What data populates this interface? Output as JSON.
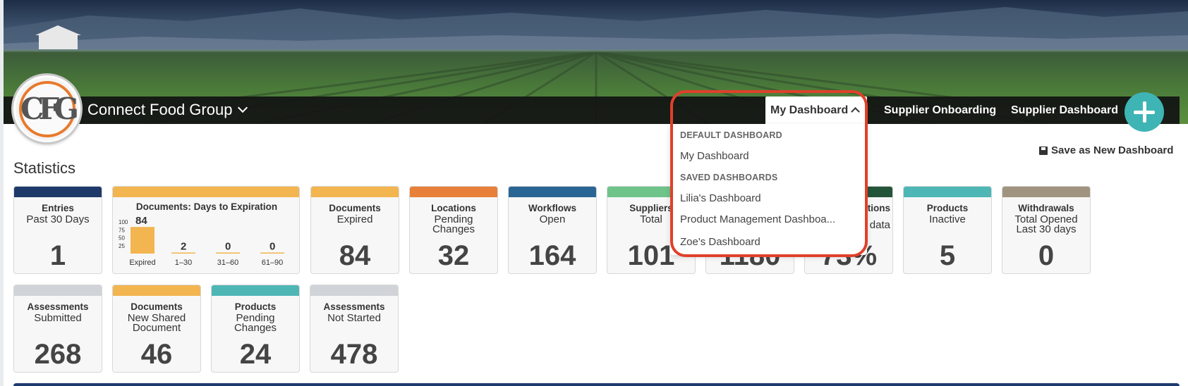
{
  "header": {
    "company_name": "Connect Food Group",
    "logo_text": "CFG",
    "nav": {
      "my_dashboard": "My Dashboard",
      "supplier_onboarding": "Supplier Onboarding",
      "supplier_dashboard": "Supplier Dashboard"
    },
    "plus_icon": "plus-icon"
  },
  "main": {
    "stats_title": "Statistics",
    "save_dashboard": "Save as New Dashboard"
  },
  "dropdown": {
    "default_header": "DEFAULT DASHBOARD",
    "default_items": [
      "My Dashboard"
    ],
    "saved_header": "SAVED DASHBOARDS",
    "saved_items": [
      "Lilia's Dashboard",
      "Product Management Dashboa...",
      "Zoe's Dashboard"
    ]
  },
  "cards": [
    {
      "title": "Entries",
      "sub": "Past 30 Days",
      "value": "1",
      "color": "#1e3a6b"
    },
    {
      "title": "Documents",
      "sub": "Expired",
      "value": "84",
      "color": "#f2b54f"
    },
    {
      "title": "Locations",
      "sub": "Pending Changes",
      "value": "32",
      "color": "#e8803a"
    },
    {
      "title": "Workflows",
      "sub": "Open",
      "value": "164",
      "color": "#2b6594"
    },
    {
      "title": "Suppliers",
      "sub": "Total",
      "value": "101",
      "color": "#6fc48a"
    },
    {
      "title": "",
      "sub": "",
      "value": "1180",
      "color": "#3fb4b5"
    },
    {
      "title": "ctions",
      "sub": "data",
      "value": "73%",
      "color": "#24553a"
    },
    {
      "title": "Products",
      "sub": "Inactive",
      "value": "5",
      "color": "#4fb6b6"
    },
    {
      "title": "Withdrawals",
      "sub": "Total Opened Last 30 days",
      "value": "0",
      "color": "#a09480"
    },
    {
      "title": "Assessments",
      "sub": "Submitted",
      "value": "268",
      "color": "#d0d4d8"
    },
    {
      "title": "Documents",
      "sub": "New Shared Document",
      "value": "46",
      "color": "#f2b54f"
    },
    {
      "title": "Products",
      "sub": "Pending Changes",
      "value": "24",
      "color": "#4fb6b6"
    },
    {
      "title": "Assessments",
      "sub": "Not Started",
      "value": "478",
      "color": "#d0d4d8"
    }
  ],
  "expiration_widget": {
    "title": "Documents: Days to Expiration",
    "bar_color": "#f2b54f",
    "header_color": "#f2b54f",
    "y_ticks": [
      "100",
      "75",
      "50",
      "25"
    ],
    "chart_data": {
      "type": "bar",
      "title": "Documents: Days to Expiration",
      "categories": [
        "Expired",
        "1–30",
        "31–60",
        "61–90"
      ],
      "values": [
        84,
        2,
        0,
        0
      ],
      "ylim": [
        0,
        100
      ]
    }
  }
}
